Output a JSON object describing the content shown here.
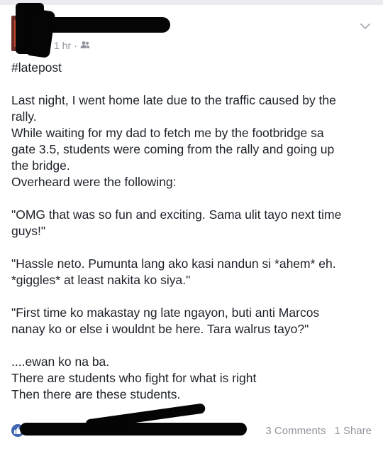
{
  "post": {
    "time": "1 hr",
    "separator": "·",
    "audience_icon": "friends-icon",
    "lines": [
      "#latepost",
      "",
      "Last night, I went home late due to the traffic caused by the",
      "rally.",
      "While waiting for my dad to fetch me by the footbridge sa",
      "gate 3.5, students were coming from the rally and going up",
      "the bridge.",
      "Overheard were the following:",
      "",
      "\"OMG that was so fun and exciting. Sama ulit tayo next time",
      "guys!\"",
      "",
      "\"Hassle neto. Pumunta lang ako kasi nandun si *ahem* eh.",
      "*giggles* at least nakita ko siya.\"",
      "",
      "\"First time ko makastay ng late ngayon, buti anti Marcos",
      "nanay ko or else i wouldnt be here. Tara walrus tayo?\"",
      "",
      "....ewan ko na ba.",
      "There are students who fight for what is right",
      "Then there are these students."
    ]
  },
  "footer": {
    "comments": "3 Comments",
    "shares": "1 Share"
  },
  "colors": {
    "accent": "#4267b2",
    "muted": "#90949c",
    "text": "#1d2129"
  }
}
